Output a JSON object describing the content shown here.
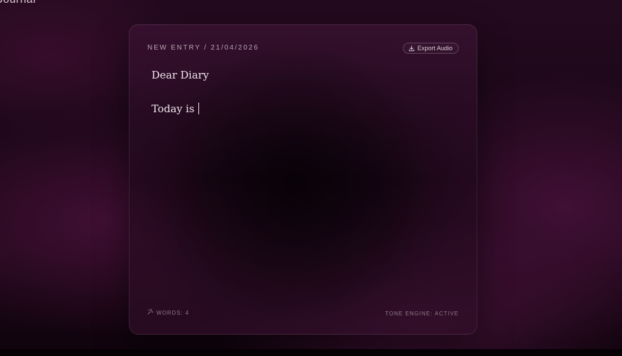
{
  "app": {
    "title": "Journal"
  },
  "entry": {
    "header": "NEW ENTRY / 21/04/2026",
    "export_label": "Export Audio",
    "export_icon": "download-icon",
    "lines": [
      "Dear Diary",
      "Today is "
    ]
  },
  "footer": {
    "words_icon": "sparkle-icon",
    "words_label": "WORDS: 4",
    "tone_status": "TONE ENGINE: ACTIVE"
  },
  "colors": {
    "background": "#1b0718",
    "card": "#2a0c24",
    "text": "#efe6ec",
    "muted": "#8f7c8a"
  }
}
